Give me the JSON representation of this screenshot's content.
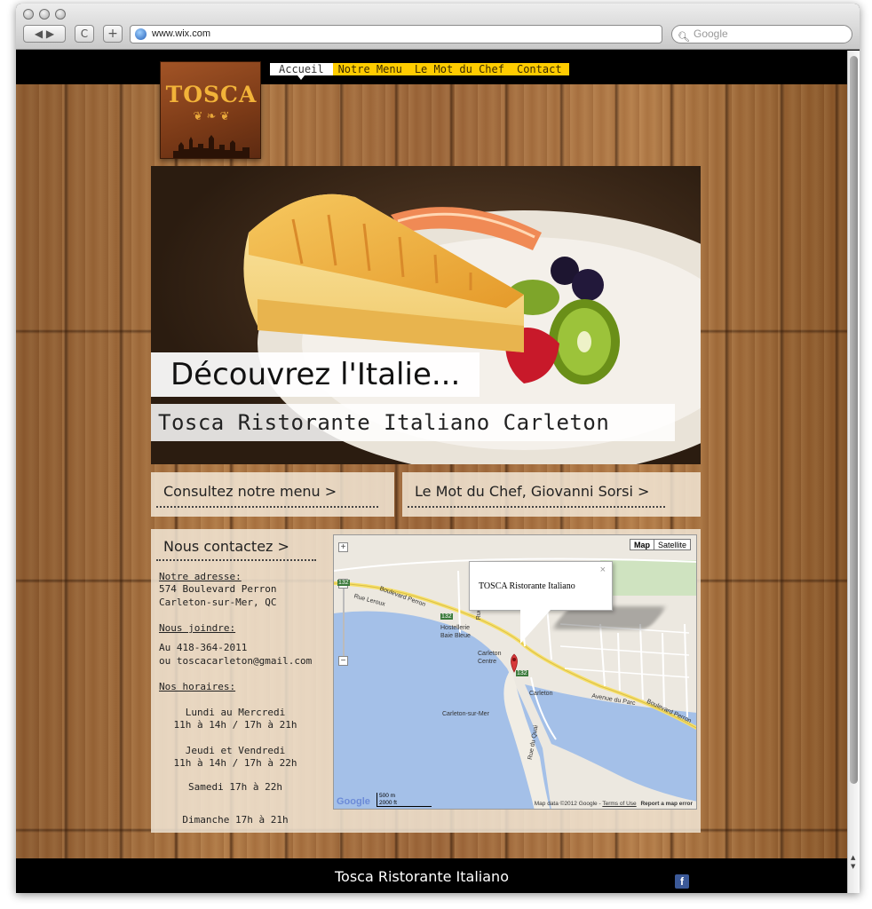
{
  "browser": {
    "url": "www.wix.com",
    "search_placeholder": "Google",
    "back_forward": "◀ ▶",
    "reload": "C",
    "new_tab": "+"
  },
  "site": {
    "logo_text": "TOSCA",
    "nav": [
      {
        "label": "Accueil",
        "active": true
      },
      {
        "label": "Notre Menu",
        "active": false
      },
      {
        "label": "Le Mot du Chef",
        "active": false
      },
      {
        "label": "Contact",
        "active": false
      }
    ],
    "hero": {
      "headline": "Découvrez l'Italie...",
      "subtitle": "Tosca Ristorante Italiano Carleton"
    },
    "links": {
      "menu": "Consultez notre menu >",
      "chef": "Le Mot du Chef, Giovanni Sorsi >"
    },
    "contact": {
      "title": "Nous contactez >",
      "address_heading": "Notre adresse:",
      "address_line1": "574 Boulevard Perron",
      "address_line2": "Carleton-sur-Mer, QC",
      "reach_heading": "Nous joindre:",
      "phone": "Au 418-364-2011",
      "email": "ou toscacarleton@gmail.com",
      "hours_heading": "Nos horaires:",
      "hours": [
        {
          "days": "Lundi au Mercredi",
          "time": "11h à 14h / 17h à 21h"
        },
        {
          "days": "Jeudi et Vendredi",
          "time": "11h à 14h / 17h à 22h"
        },
        {
          "days": "Samedi 17h à 22h",
          "time": ""
        },
        {
          "days": "Dimanche 17h à 21h",
          "time": ""
        }
      ]
    },
    "map": {
      "btn_map": "Map",
      "btn_satellite": "Satellite",
      "info_title": "TOSCA Ristorante Italiano",
      "close": "×",
      "zoom_in": "+",
      "zoom_out": "−",
      "labels": {
        "blvd_perron": "Boulevard Perron",
        "rue_leroux": "Rue Leroux",
        "hostellerie": "Hostellerie",
        "baie_bleue": "Baie Bleue",
        "carleton_centre_1": "Carleton",
        "carleton_centre_2": "Centre",
        "carleton": "Carleton",
        "carleton_sur_mer": "Carleton-sur-Mer",
        "rue_de_la_gare": "Rue de la Gare",
        "rue_du_quai": "Rue du Quai",
        "avenue_du_parc": "Avenue du Parc",
        "boulevard_perron_2": "Boulevard Perron",
        "route_132_a": "132",
        "route_132_b": "132",
        "route_132_c": "132"
      },
      "scale_m": "500 m",
      "scale_ft": "2000 ft",
      "attribution": "Map data ©2012 Google -",
      "terms": "Terms of Use",
      "report": "Report a map error",
      "google_logo": "Google"
    },
    "footer_title": "Tosca Ristorante Italiano",
    "facebook_icon": "f"
  },
  "colors": {
    "nav_yellow": "#ffcc00",
    "logo_gold": "#f2b339",
    "logo_brown": "#7b3a17",
    "water": "#a4c0e8"
  }
}
